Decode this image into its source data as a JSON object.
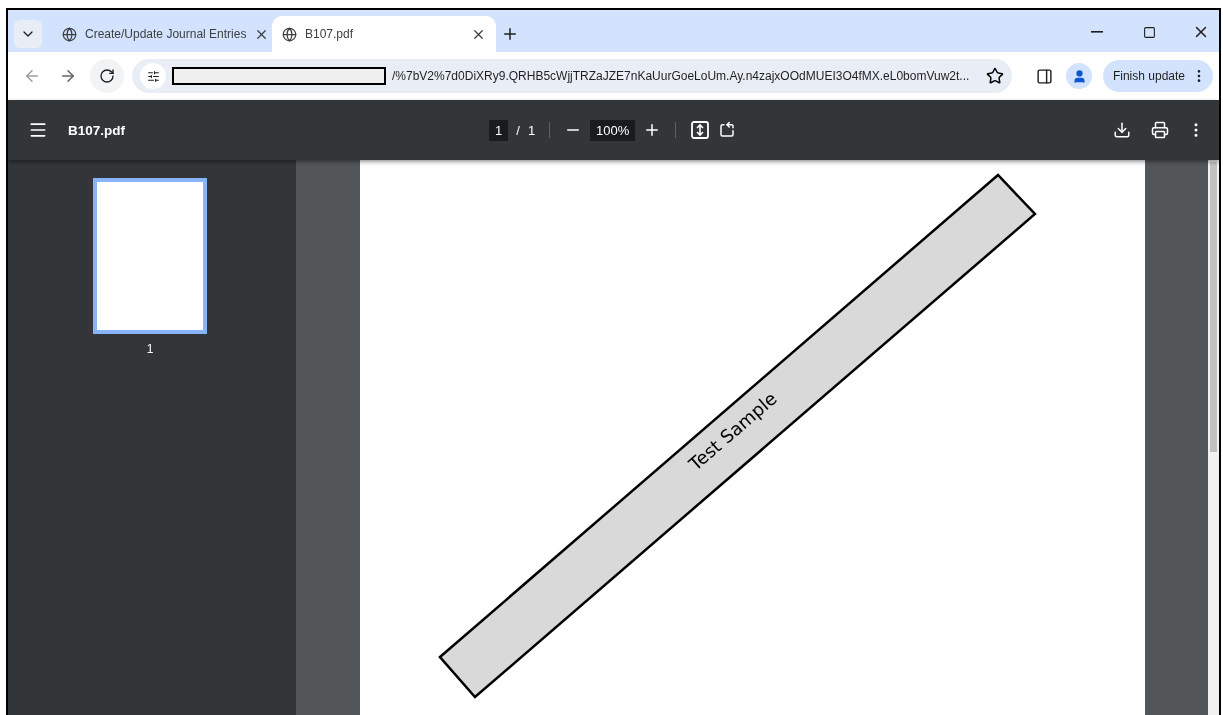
{
  "tabs": [
    {
      "title": "Create/Update Journal Entries",
      "selected": false
    },
    {
      "title": "B107.pdf",
      "selected": true
    }
  ],
  "address_bar": {
    "url": "/%7bV2%7d0DiXRy9.QRHB5cWjjTRZaJZE7nKaUurGoeLoUm.Ay.n4zajxOOdMUEI3O4fMX.eL0bomVuw2t...",
    "redacted": true
  },
  "update_button": "Finish update",
  "pdf_toolbar": {
    "file_name": "B107.pdf",
    "page": "1",
    "separator": "/",
    "total_pages": "1",
    "zoom": "100%"
  },
  "thumbnails": [
    {
      "label": "1",
      "selected": true
    }
  ],
  "document": {
    "stamp_text": "Test Sample"
  }
}
